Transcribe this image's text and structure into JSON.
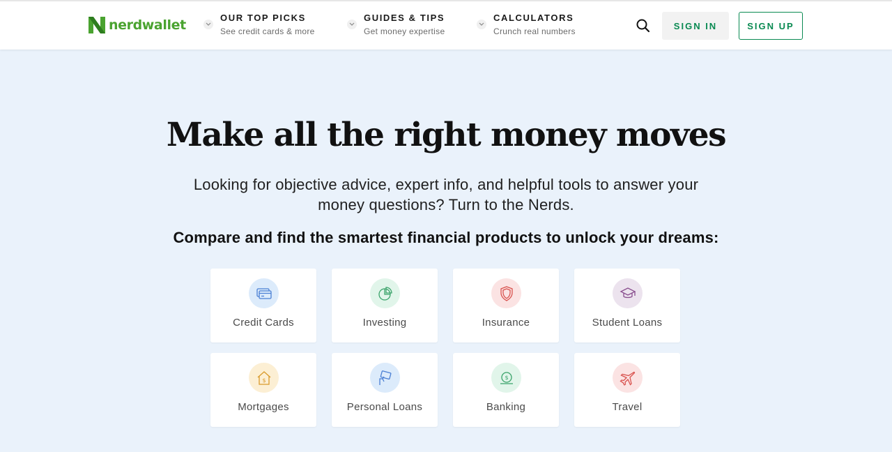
{
  "header": {
    "logo_text": "nerdwallet",
    "brand_color": "#4aa330",
    "nav": [
      {
        "title": "OUR TOP PICKS",
        "subtitle": "See credit cards & more"
      },
      {
        "title": "GUIDES & TIPS",
        "subtitle": "Get money expertise"
      },
      {
        "title": "CALCULATORS",
        "subtitle": "Crunch real numbers"
      }
    ],
    "search_icon": "search-icon",
    "sign_in_label": "SIGN IN",
    "sign_up_label": "SIGN UP",
    "accent_color": "#0a8a52"
  },
  "hero": {
    "title": "Make all the right money moves",
    "subtitle": "Looking for objective advice, expert info, and helpful tools to answer your money questions? Turn to the Nerds.",
    "compare_heading": "Compare and find the smartest financial products to unlock your dreams:"
  },
  "categories": [
    {
      "label": "Credit Cards",
      "icon": "credit-card-icon",
      "icon_bg": "#dcebfb",
      "icon_color": "#4a7fd4"
    },
    {
      "label": "Investing",
      "icon": "pie-chart-icon",
      "icon_bg": "#e1f5ea",
      "icon_color": "#3aa36a"
    },
    {
      "label": "Insurance",
      "icon": "shield-icon",
      "icon_bg": "#fbe3e3",
      "icon_color": "#d9534f"
    },
    {
      "label": "Student Loans",
      "icon": "graduation-cap-icon",
      "icon_bg": "#ece3ee",
      "icon_color": "#8a4f8f"
    },
    {
      "label": "Mortgages",
      "icon": "house-icon",
      "icon_bg": "#fcefd4",
      "icon_color": "#d99a2b"
    },
    {
      "label": "Personal Loans",
      "icon": "money-hand-icon",
      "icon_bg": "#dcebfb",
      "icon_color": "#4a7fd4"
    },
    {
      "label": "Banking",
      "icon": "bank-note-icon",
      "icon_bg": "#e1f5ea",
      "icon_color": "#3aa36a"
    },
    {
      "label": "Travel",
      "icon": "airplane-icon",
      "icon_bg": "#fbe3e3",
      "icon_color": "#d9534f"
    }
  ]
}
